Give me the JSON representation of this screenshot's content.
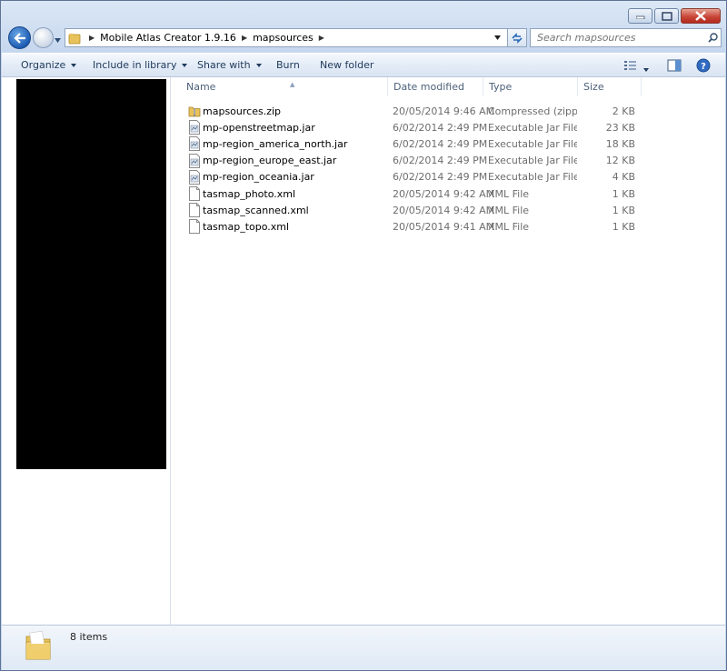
{
  "window": {
    "buttons": [
      "minimize",
      "maximize",
      "close"
    ]
  },
  "address": {
    "crumbs": [
      "Mobile Atlas Creator 1.9.16",
      "mapsources"
    ]
  },
  "search": {
    "placeholder": "Search mapsources"
  },
  "toolbar": {
    "organize": "Organize",
    "include_in_library": "Include in library",
    "share_with": "Share with",
    "burn": "Burn",
    "new_folder": "New folder"
  },
  "columns": {
    "name": "Name",
    "date_modified": "Date modified",
    "type": "Type",
    "size": "Size"
  },
  "files": [
    {
      "icon": "zip-folder-icon",
      "name": "mapsources.zip",
      "date": "20/05/2014 9:46 AM",
      "type": "Compressed (zipp...",
      "size": "2 KB"
    },
    {
      "icon": "jar-file-icon",
      "name": "mp-openstreetmap.jar",
      "date": "6/02/2014 2:49 PM",
      "type": "Executable Jar File",
      "size": "23 KB"
    },
    {
      "icon": "jar-file-icon",
      "name": "mp-region_america_north.jar",
      "date": "6/02/2014 2:49 PM",
      "type": "Executable Jar File",
      "size": "18 KB"
    },
    {
      "icon": "jar-file-icon",
      "name": "mp-region_europe_east.jar",
      "date": "6/02/2014 2:49 PM",
      "type": "Executable Jar File",
      "size": "12 KB"
    },
    {
      "icon": "jar-file-icon",
      "name": "mp-region_oceania.jar",
      "date": "6/02/2014 2:49 PM",
      "type": "Executable Jar File",
      "size": "4 KB"
    },
    {
      "icon": "xml-file-icon",
      "name": "tasmap_photo.xml",
      "date": "20/05/2014 9:42 AM",
      "type": "XML File",
      "size": "1 KB"
    },
    {
      "icon": "xml-file-icon",
      "name": "tasmap_scanned.xml",
      "date": "20/05/2014 9:42 AM",
      "type": "XML File",
      "size": "1 KB"
    },
    {
      "icon": "xml-file-icon",
      "name": "tasmap_topo.xml",
      "date": "20/05/2014 9:41 AM",
      "type": "XML File",
      "size": "1 KB"
    }
  ],
  "status": {
    "item_count": "8 items"
  },
  "colors": {
    "accent": "#1e395b",
    "folder": "#e8c25a",
    "redaction": "#000000"
  }
}
